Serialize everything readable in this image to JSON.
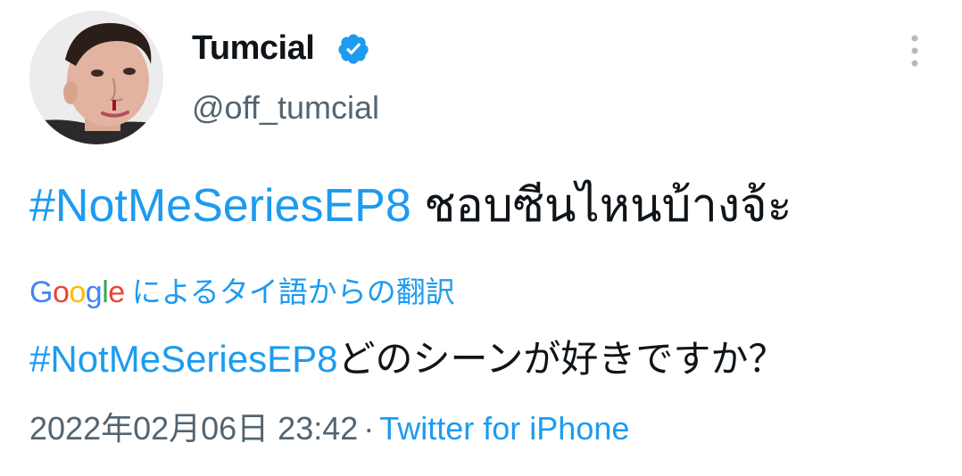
{
  "author": {
    "display_name": "Tumcial",
    "handle": "@off_tumcial",
    "verified": true,
    "avatar_icon": "profile-photo"
  },
  "tweet": {
    "hashtag": "#NotMeSeriesEP8",
    "text": " ชอบซีนไหนบ้างจ้ะ"
  },
  "translation": {
    "provider_logo_letters": [
      "G",
      "o",
      "o",
      "g",
      "l",
      "e"
    ],
    "label": "によるタイ語からの翻訳",
    "hashtag": "#NotMeSeriesEP8",
    "text": "どのシーンが好きですか？"
  },
  "meta": {
    "timestamp": "2022年02月06日 23:42",
    "separator": "·",
    "source": "Twitter for iPhone"
  },
  "colors": {
    "link": "#1d9bf0",
    "secondary_text": "#536471",
    "primary_text": "#0f1419",
    "verified_badge": "#1d9bf0",
    "google_blue": "#4285f4",
    "google_red": "#ea4335",
    "google_yellow": "#fbbc05",
    "google_green": "#34a853"
  },
  "icons": {
    "verified": "verified-badge-icon",
    "more": "more-options-icon"
  }
}
